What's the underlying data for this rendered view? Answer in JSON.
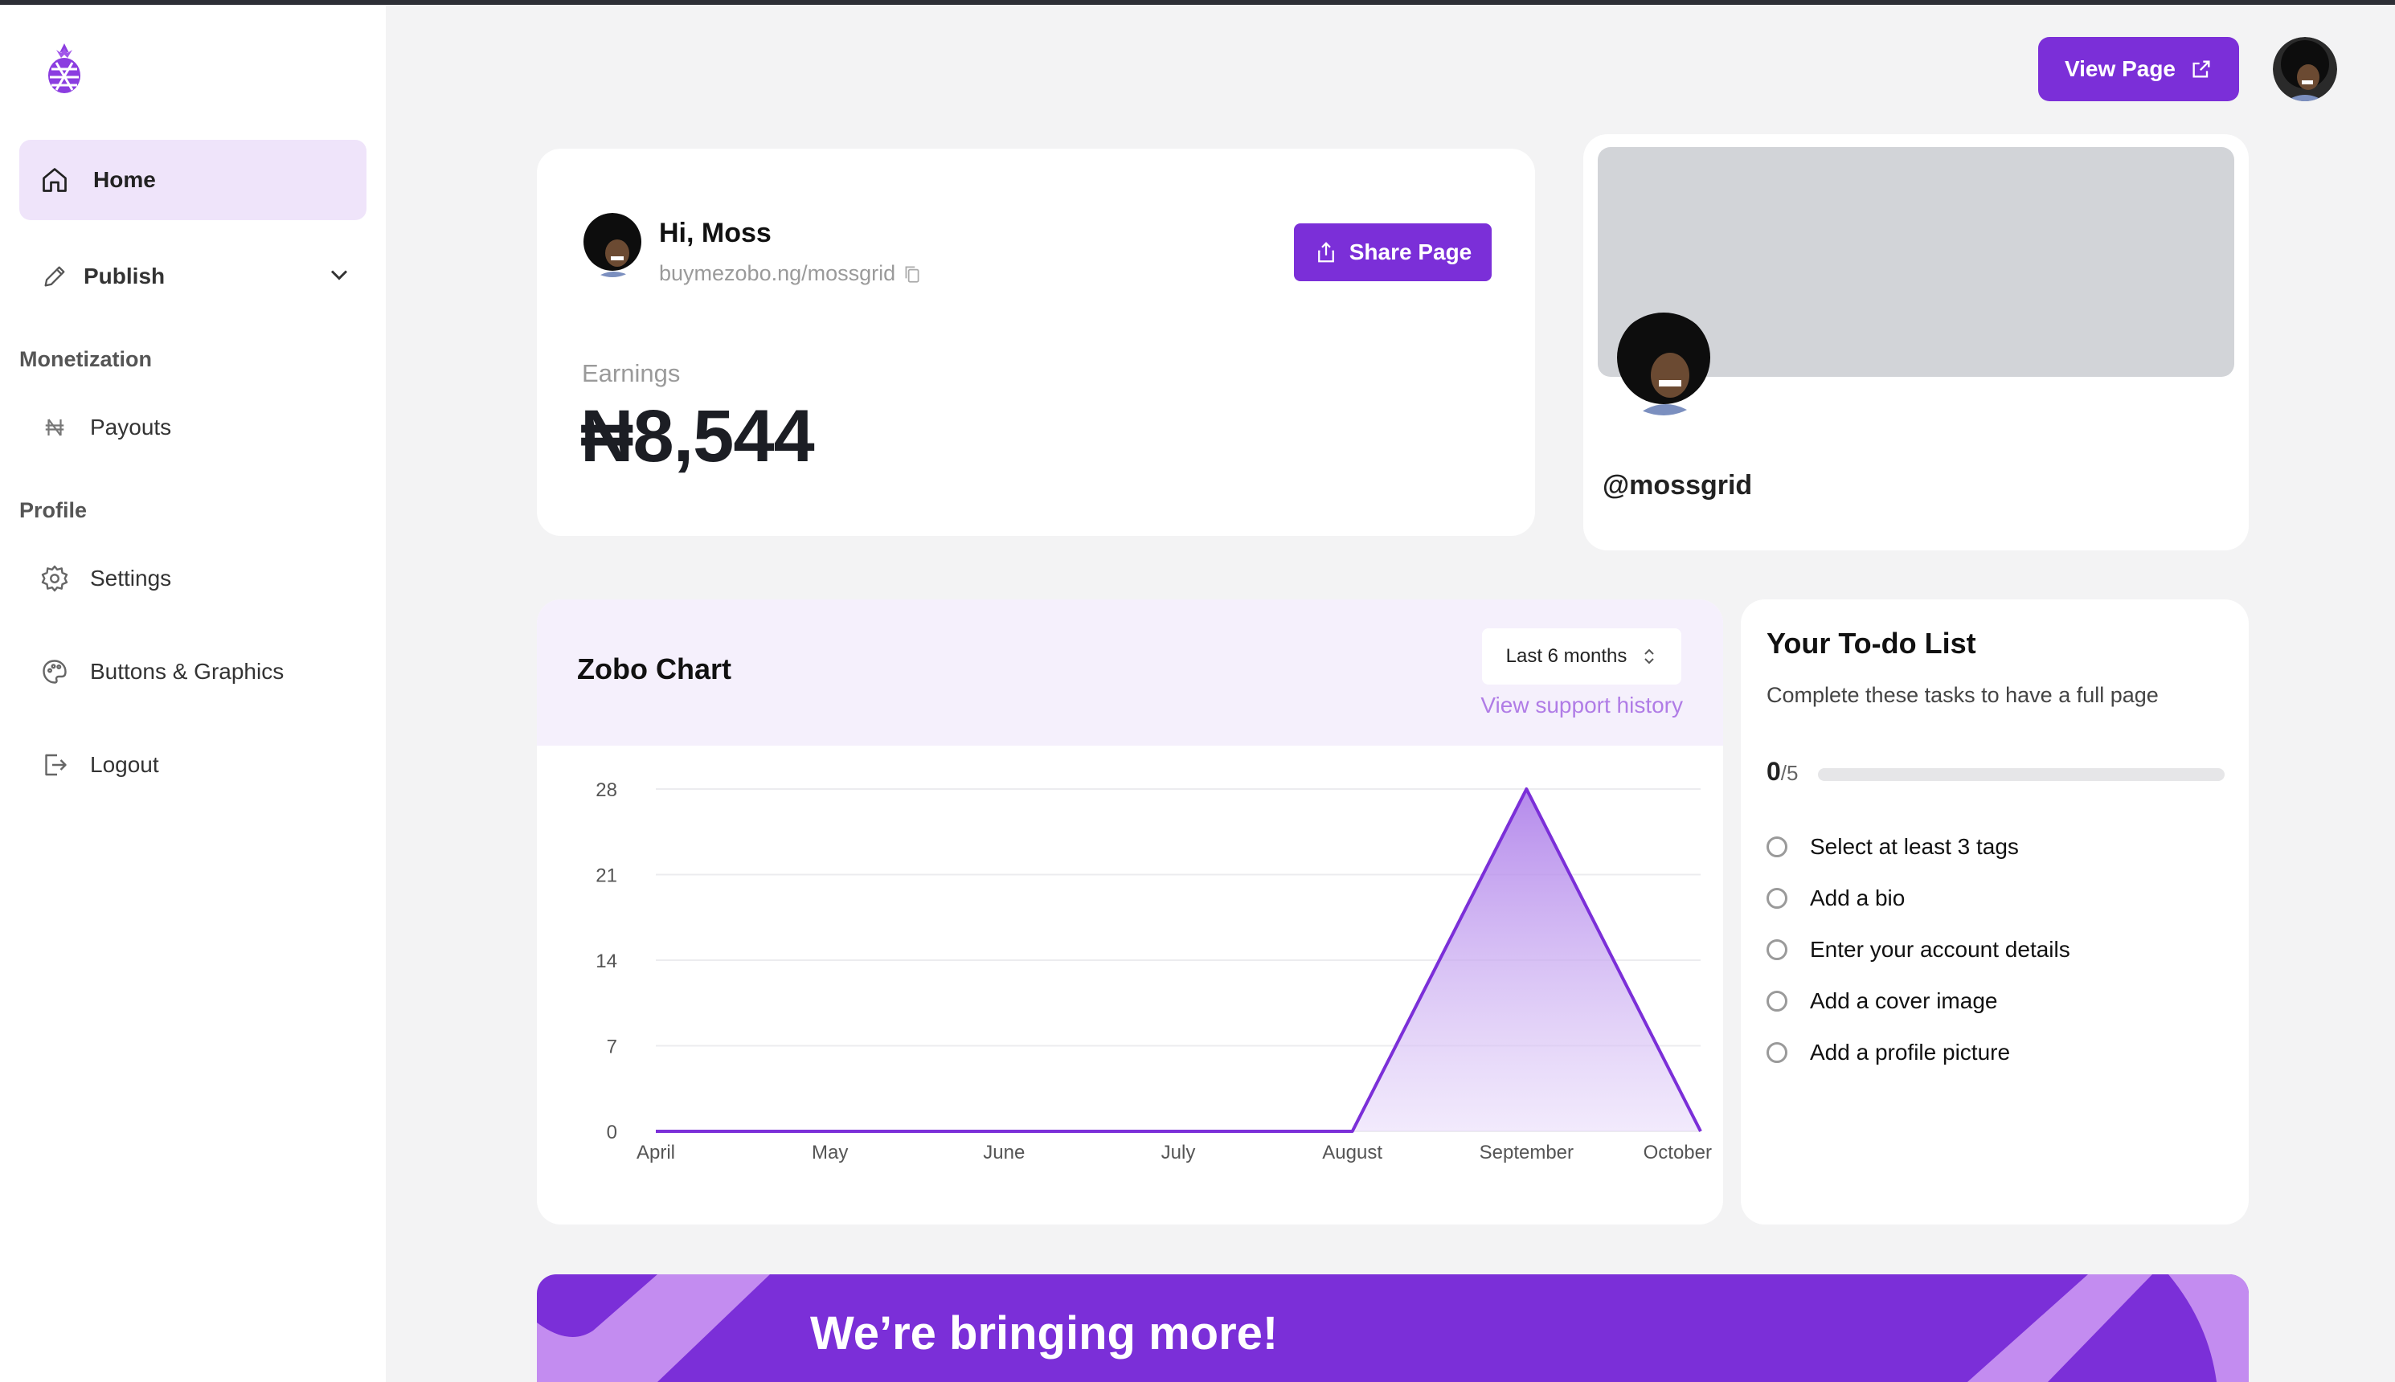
{
  "sidebar": {
    "home": "Home",
    "publish": "Publish",
    "monetization_title": "Monetization",
    "payouts": "Payouts",
    "profile_title": "Profile",
    "settings": "Settings",
    "buttons_graphics": "Buttons & Graphics",
    "logout": "Logout"
  },
  "header": {
    "view_page": "View Page"
  },
  "welcome": {
    "greeting": "Hi, Moss",
    "url": "buymezobo.ng/mossgrid",
    "share_button": "Share Page",
    "earnings_label": "Earnings",
    "earnings_value": "₦8,544"
  },
  "profile_card": {
    "handle": "@mossgrid"
  },
  "chart_card": {
    "title": "Zobo Chart",
    "range": "Last 6 months",
    "support_link": "View support history"
  },
  "chart_data": {
    "type": "area",
    "categories": [
      "April",
      "May",
      "June",
      "July",
      "August",
      "September",
      "October"
    ],
    "values": [
      0,
      0,
      0,
      0,
      0,
      28,
      0
    ],
    "yticks": [
      0,
      7,
      14,
      21,
      28
    ],
    "ylim": [
      0,
      28
    ],
    "grid": true,
    "color": "#7b2fd8"
  },
  "todo": {
    "title": "Your To-do List",
    "subtitle": "Complete these tasks to have a full page",
    "done": "0",
    "total": "/5",
    "progress": 0,
    "items": [
      "Select at least 3 tags",
      "Add a bio",
      "Enter your account details",
      "Add a cover image",
      "Add a profile picture"
    ]
  },
  "banner": {
    "text": "We’re bringing more!"
  },
  "colors": {
    "accent": "#7b2fd8",
    "accent_light": "#efe4fa",
    "muted": "#9a9a9a"
  }
}
